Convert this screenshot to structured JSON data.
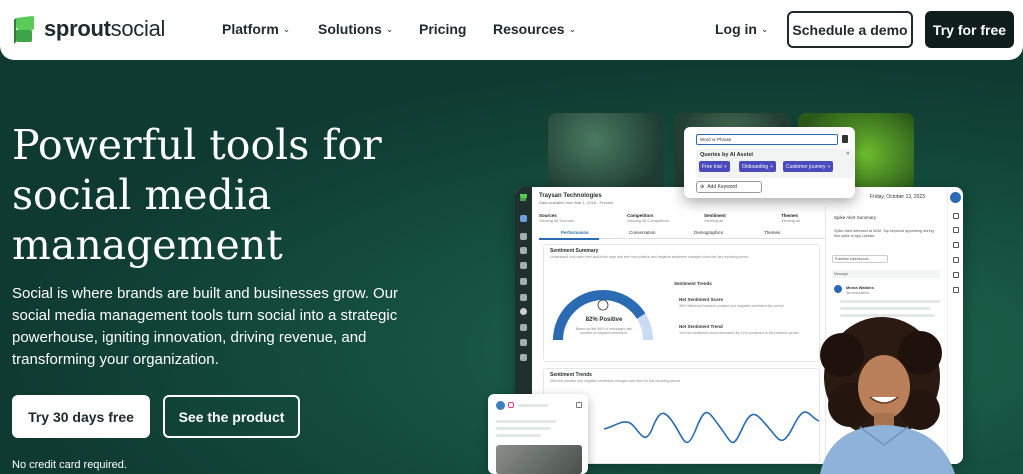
{
  "nav": {
    "logo_bold": "sprout",
    "logo_light": "social",
    "items": [
      {
        "label": "Platform",
        "has_dropdown": true
      },
      {
        "label": "Solutions",
        "has_dropdown": true
      },
      {
        "label": "Pricing",
        "has_dropdown": false
      },
      {
        "label": "Resources",
        "has_dropdown": true
      }
    ],
    "login": "Log in",
    "demo_button": "Schedule a demo",
    "try_button": "Try for free"
  },
  "hero": {
    "headline": "Powerful tools for social media management",
    "subtext": "Social is where brands are built and businesses grow. Our social media management tools turn social into a strategic powerhouse, igniting innovation, driving revenue, and transforming your organization.",
    "primary_cta": "Try 30 days free",
    "secondary_cta": "See the product",
    "disclaimer": "No credit card required."
  },
  "dashboard": {
    "company": "Traysan Technologies",
    "company_sub": "Data available from Mar 1, 2018 - Present",
    "date": "Friday, October 13, 2023",
    "filters": [
      {
        "label": "Sources",
        "value": "Viewing All Sources"
      },
      {
        "label": "Competitors",
        "value": "Viewing All Competitors"
      },
      {
        "label": "Sentiment",
        "value": "Viewing all"
      },
      {
        "label": "Themes",
        "value": "Viewing all"
      }
    ],
    "tabs": [
      "Performance",
      "Conversation",
      "Demographics",
      "Themes"
    ],
    "sentiment_summary": {
      "title": "Sentiment Summary",
      "subtitle": "Understand how users feel about this topic and see how positive and negative sentiment changed since the last reporting period.",
      "gauge_value": "82% Positive",
      "gauge_percent": 82,
      "gauge_caption": "Based on the 96% of messages with positive or negative sentiment.",
      "trends_title": "Sentiment Trends",
      "net_score_label": "Net Sentiment Score",
      "net_score_text": "38% difference between positive and negative sentiment this period",
      "net_trend_label": "Net Sentiment Trend",
      "net_trend_text": "Your net sentiment score decreased by 11% compared to the previous period"
    },
    "sentiment_trends": {
      "title": "Sentiment Trends",
      "subtitle": "View the positive and negative sentiment changes over time for this reporting period."
    },
    "spike_panel": {
      "title": "Spike Alert Summary",
      "text": "Spike Alert detected at 9AM. Top keyword appearing during this spike is App Update",
      "select": "Potential Impressions",
      "message_label": "Message",
      "author": "Minna Watkins",
      "author_handle": "@minnawatkins"
    },
    "popup": {
      "input_placeholder": "Word or Phrase",
      "label": "Queries by AI Assist",
      "chips": [
        "Free trial",
        "Onboarding",
        "Customer journey"
      ],
      "add_label": "Add Keyword"
    }
  },
  "colors": {
    "brand_green": "#59cb59",
    "hero_bg": "#0f3a31",
    "accent_blue": "#2a6bb3",
    "chip_purple": "#4b4bbd"
  }
}
